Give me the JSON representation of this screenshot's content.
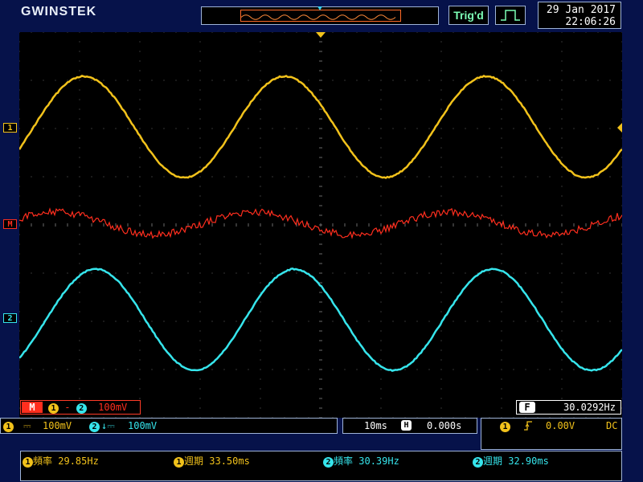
{
  "header": {
    "logo": "GWINSTEK",
    "trigger_status": "Trig'd",
    "date": "29 Jan 2017",
    "time": "22:06:26"
  },
  "channels": {
    "ch1_marker": "1",
    "math_marker": "M",
    "ch2_marker": "2"
  },
  "math": {
    "label": "M",
    "ch_a": "1",
    "operator": "-",
    "ch_b": "2",
    "scale": "100mV"
  },
  "frequency_counter": {
    "label": "F",
    "value": "30.0292Hz"
  },
  "channel_bar": {
    "ch1_id": "1",
    "ch1_coupling": "⎓",
    "ch1_scale": "100mV",
    "ch2_id": "2",
    "ch2_coupling": "↓⎓",
    "ch2_scale": "100mV"
  },
  "timebase": {
    "scale": "10ms",
    "position_icon": "H",
    "position": "0.000s"
  },
  "trigger": {
    "source": "1",
    "slope_icon": "rising-edge-icon",
    "level": "0.00V",
    "coupling": "DC"
  },
  "measurements": [
    {
      "ch": "1",
      "name": "頻率",
      "value": "29.85Hz"
    },
    {
      "ch": "1",
      "name": "週期",
      "value": "33.50ms"
    },
    {
      "ch": "2",
      "name": "頻率",
      "value": "30.39Hz"
    },
    {
      "ch": "2",
      "name": "週期",
      "value": "32.90ms"
    }
  ],
  "colors": {
    "ch1": "#f2c21b",
    "ch2": "#36e5ec",
    "math": "#ff2e1e",
    "background": "#06124a"
  }
}
